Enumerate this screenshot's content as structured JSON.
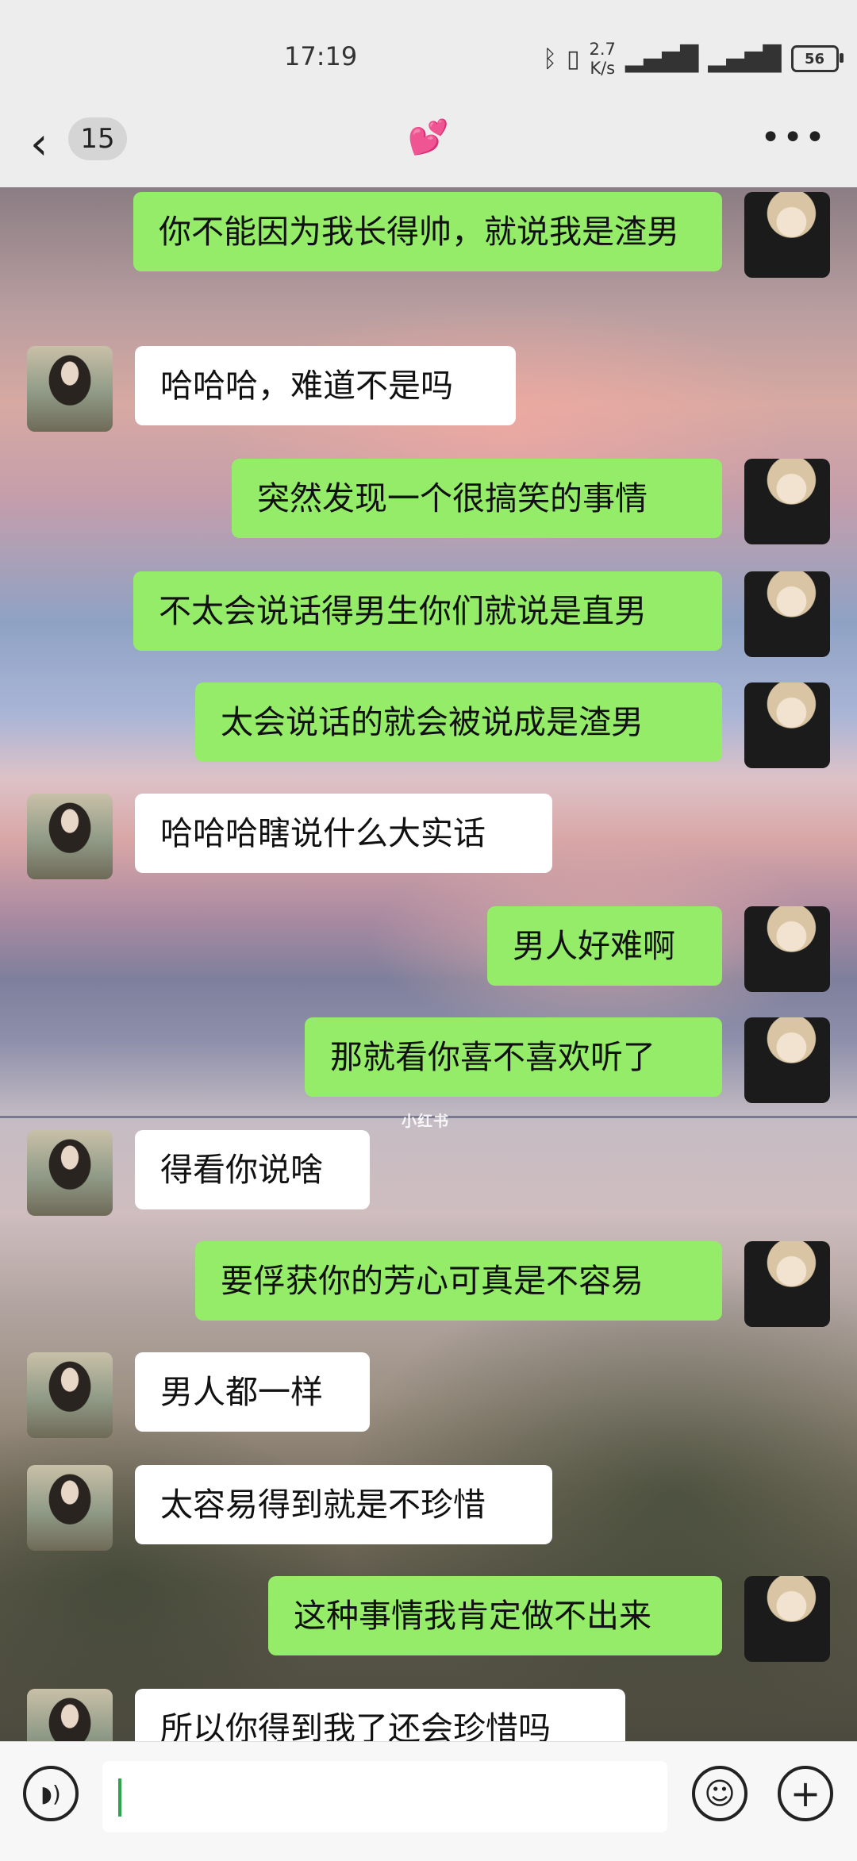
{
  "status_bar": {
    "time": "17:19",
    "net_speed_value": "2.7",
    "net_speed_unit": "K/s",
    "battery": "56",
    "icons": [
      "bluetooth-icon",
      "vibrate-icon",
      "signal-5g-icon",
      "signal-5g-icon",
      "battery-icon"
    ]
  },
  "nav": {
    "back_icon": "chevron-left-icon",
    "unread_count": "15",
    "title": "💕",
    "more_icon": "more-dots-icon"
  },
  "chat": {
    "watermark": "小红书",
    "colors": {
      "me_bubble": "#95ec69",
      "her_bubble": "#ffffff"
    },
    "messages": [
      {
        "from": "me",
        "text": "你不能因为我长得帅，就说我是渣男"
      },
      {
        "from": "her",
        "text": "哈哈哈，难道不是吗"
      },
      {
        "from": "me",
        "text": "突然发现一个很搞笑的事情"
      },
      {
        "from": "me",
        "text": "不太会说话得男生你们就说是直男"
      },
      {
        "from": "me",
        "text": "太会说话的就会被说成是渣男"
      },
      {
        "from": "her",
        "text": "哈哈哈瞎说什么大实话"
      },
      {
        "from": "me",
        "text": "男人好难啊"
      },
      {
        "from": "me",
        "text": "那就看你喜不喜欢听了"
      },
      {
        "from": "her",
        "text": "得看你说啥"
      },
      {
        "from": "me",
        "text": "要俘获你的芳心可真是不容易"
      },
      {
        "from": "her",
        "text": "男人都一样"
      },
      {
        "from": "her",
        "text": "太容易得到就是不珍惜"
      },
      {
        "from": "me",
        "text": "这种事情我肯定做不出来"
      },
      {
        "from": "her",
        "text": "所以你得到我了还会珍惜吗"
      }
    ]
  },
  "input_bar": {
    "voice_icon": "voice-icon",
    "text_value": "",
    "emoji_icon": "emoji-icon",
    "plus_icon": "plus-icon"
  }
}
